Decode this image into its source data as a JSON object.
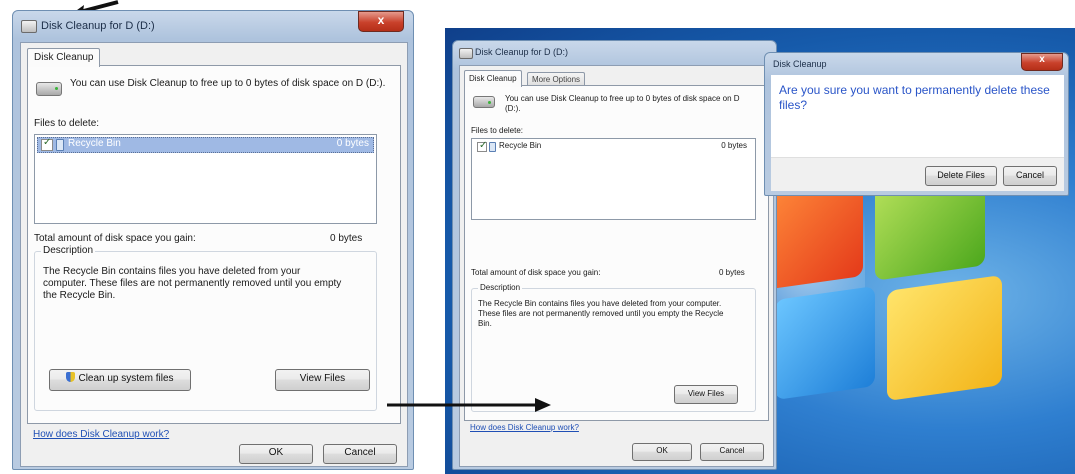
{
  "window1": {
    "title": "Disk Cleanup for D (D:)",
    "close_glyph": "x",
    "tab": "Disk Cleanup",
    "intro": "You can use Disk Cleanup to free up to 0 bytes of disk space on D (D:).",
    "files_label": "Files to delete:",
    "row": {
      "name": "Recycle Bin",
      "size": "0 bytes"
    },
    "total_label": "Total amount of disk space you gain:",
    "total_value": "0 bytes",
    "desc_label": "Description",
    "desc_text": "The Recycle Bin contains files you have deleted from your computer. These files are not permanently removed until you empty the Recycle Bin.",
    "cleanup_button": "Clean up system files",
    "view_button": "View Files",
    "link": "How does Disk Cleanup work?",
    "ok": "OK",
    "cancel": "Cancel"
  },
  "window2": {
    "title": "Disk Cleanup for D (D:)",
    "tabs": [
      "Disk Cleanup",
      "More Options"
    ],
    "intro": "You can use Disk Cleanup to free up to 0 bytes of disk space on D (D:).",
    "files_label": "Files to delete:",
    "row": {
      "name": "Recycle Bin",
      "size": "0 bytes"
    },
    "total_label": "Total amount of disk space you gain:",
    "total_value": "0 bytes",
    "desc_label": "Description",
    "desc_text": "The Recycle Bin contains files you have deleted from your computer. These files are not permanently removed until you empty the Recycle Bin.",
    "view_button": "View Files",
    "link": "How does Disk Cleanup work?",
    "ok": "OK",
    "cancel": "Cancel"
  },
  "confirm_dialog": {
    "title": "Disk Cleanup",
    "message": "Are you sure you want to permanently delete these files?",
    "delete_button": "Delete Files",
    "cancel_button": "Cancel"
  },
  "colors": {
    "accent": "#1f4fb5",
    "title_blue": "#2a55c8",
    "arrow": "#111111"
  }
}
